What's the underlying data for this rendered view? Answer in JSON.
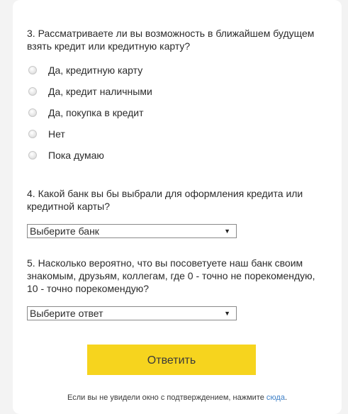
{
  "q3": {
    "title": "3. Рассматриваете ли вы возможность в ближайшем будущем взять кредит или кредитную карту?",
    "options": [
      "Да, кредитную карту",
      "Да, кредит наличными",
      "Да, покупка в кредит",
      "Нет",
      "Пока думаю"
    ]
  },
  "q4": {
    "title": "4. Какой банк вы бы выбрали для оформления кредита или кредитной карты?",
    "select_value": "Выберите банк"
  },
  "q5": {
    "title": "5. Насколько вероятно, что вы посоветуете наш банк своим знакомым, друзьям, коллегам, где 0 - точно не порекомендую, 10 - точно порекомендую?",
    "select_value": "Выберите ответ"
  },
  "submit_label": "Ответить",
  "footnote": {
    "text": "Если вы не увидели окно с подтверждением, нажмите ",
    "link": "сюда",
    "end": "."
  },
  "icons": {
    "dropdown_arrow": "▼"
  },
  "colors": {
    "button": "#f6d41e",
    "link": "#3c7fc6",
    "background": "#f3f3f3"
  }
}
